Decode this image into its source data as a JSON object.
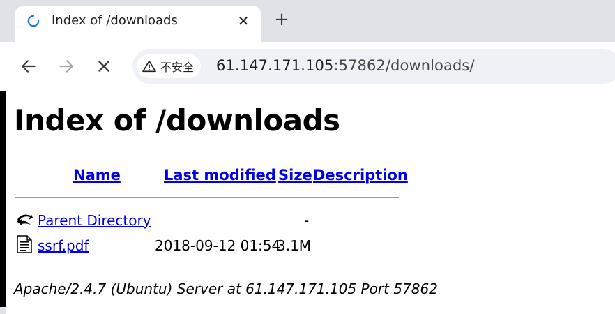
{
  "browser": {
    "tab_title": "Index of /downloads",
    "new_tab_symbol": "+",
    "close_symbol": "✕",
    "security_label": "不安全",
    "url_host": "61.147.171.105",
    "url_path": ":57862/downloads/"
  },
  "page": {
    "title": "Index of /downloads",
    "columns": [
      "Name",
      "Last modified",
      "Size",
      "Description"
    ],
    "rows": [
      {
        "icon": "back-arrow-icon",
        "name": "Parent Directory",
        "modified": "",
        "size": "-",
        "description": ""
      },
      {
        "icon": "document-icon",
        "name": "ssrf.pdf",
        "modified": "2018-09-12 01:54",
        "size": "3.1M",
        "description": ""
      }
    ],
    "footer": "Apache/2.4.7 (Ubuntu) Server at 61.147.171.105 Port 57862"
  },
  "colors": {
    "link": "#0000ee",
    "tabstrip_bg": "#dfe3e8",
    "omnibox_bg": "#eef1f5",
    "spinner": "#1a73e8"
  }
}
